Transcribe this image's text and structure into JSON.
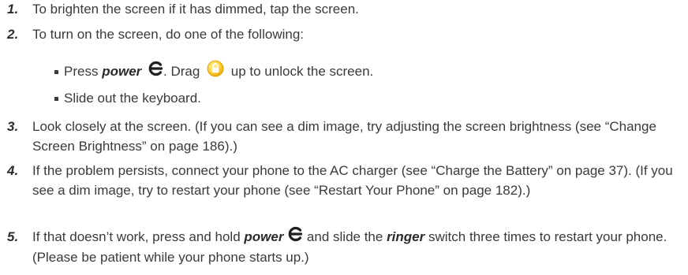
{
  "steps": [
    {
      "num": "1.",
      "text": "To brighten the screen if it has dimmed, tap the screen."
    },
    {
      "num": "2.",
      "text": "To turn on the screen, do one of the following:",
      "bullets": {
        "b1_press": "Press",
        "b1_power": "power",
        "b1_drag": ". Drag",
        "b1_rest": "up to unlock the screen.",
        "b2": "Slide out the keyboard."
      }
    },
    {
      "num": "3.",
      "text": "Look closely at the screen. (If you can see a dim image, try adjusting the screen brightness (see “Change Screen Brightness” on page 186).)"
    },
    {
      "num": "4.",
      "text": "If the problem persists, connect your phone to the AC charger (see “Charge the Battery” on page 37). (If you see a dim image, try to restart your phone (see “Restart Your Phone” on page 182).)"
    },
    {
      "num": "5.",
      "text_a": "If that doesn’t work, press and hold",
      "power": "power",
      "text_b": "and slide the",
      "ringer": "ringer",
      "text_c": "switch three times to restart your phone. (Please be patient while your phone starts up.)"
    }
  ],
  "icons": {
    "power": "power-icon",
    "unlock": "unlock-icon"
  },
  "colors": {
    "text": "#3a3a3a",
    "power_icon": "#1f1f1f",
    "unlock_icon": "#f2b400"
  }
}
